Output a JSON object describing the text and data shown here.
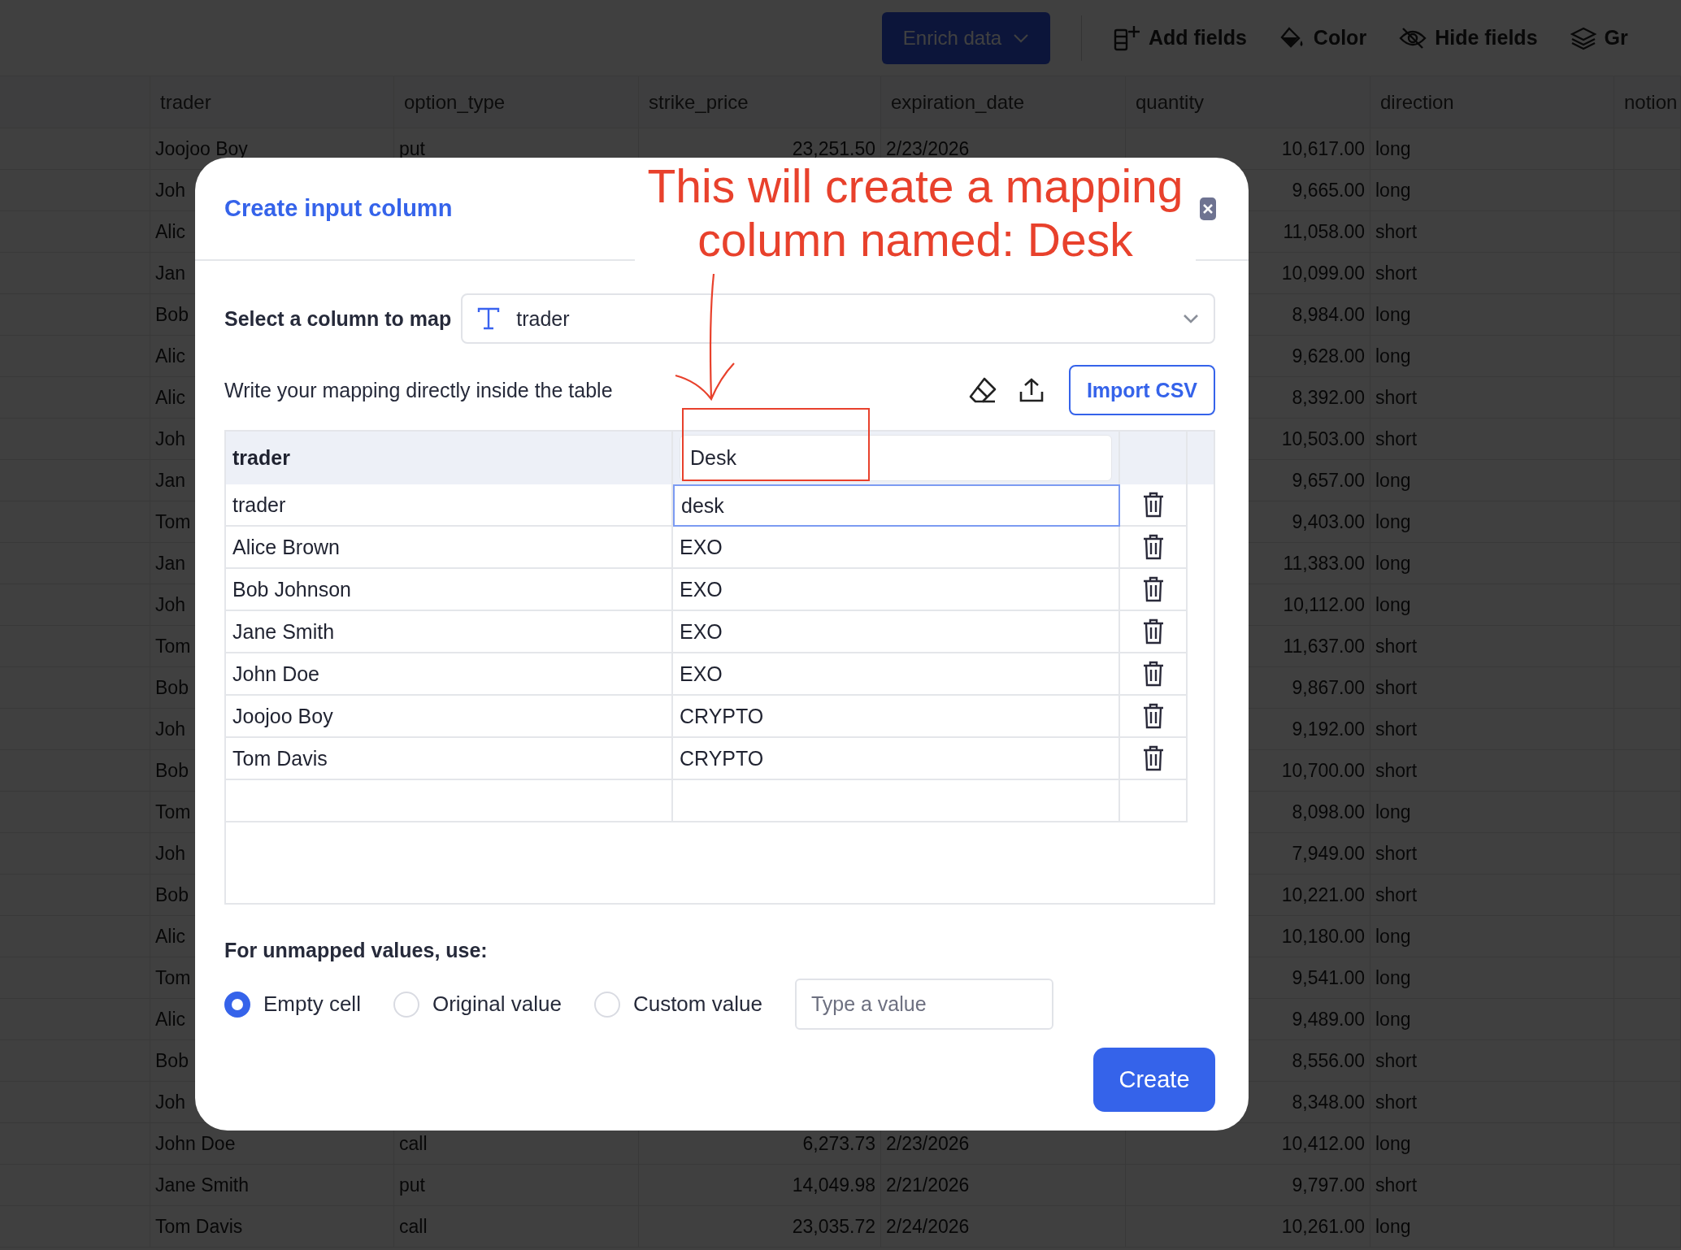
{
  "toolbar": {
    "enrich_button": "Enrich data",
    "actions": [
      {
        "kind": "add-fields",
        "label": "Add fields"
      },
      {
        "kind": "color",
        "label": "Color"
      },
      {
        "kind": "hide-fields",
        "label": "Hide fields"
      },
      {
        "kind": "group",
        "label": "Gr"
      }
    ]
  },
  "table": {
    "columns": [
      "trader",
      "option_type",
      "strike_price",
      "expiration_date",
      "quantity",
      "direction",
      "notion"
    ],
    "rows": [
      {
        "trader": "Joojoo Boy",
        "option_type": "put",
        "strike_price": "23,251.50",
        "expiration_date": "2/23/2026",
        "quantity": "10,617.00",
        "direction": "long"
      },
      {
        "trader": "Joh",
        "quantity": "9,665.00",
        "direction": "long"
      },
      {
        "trader": "Alic",
        "quantity": "11,058.00",
        "direction": "short"
      },
      {
        "trader": "Jan",
        "quantity": "10,099.00",
        "direction": "short"
      },
      {
        "trader": "Bob",
        "quantity": "8,984.00",
        "direction": "long"
      },
      {
        "trader": "Alic",
        "quantity": "9,628.00",
        "direction": "long"
      },
      {
        "trader": "Alic",
        "quantity": "8,392.00",
        "direction": "short"
      },
      {
        "trader": "Joh",
        "quantity": "10,503.00",
        "direction": "short"
      },
      {
        "trader": "Jan",
        "quantity": "9,657.00",
        "direction": "long"
      },
      {
        "trader": "Tom",
        "quantity": "9,403.00",
        "direction": "long"
      },
      {
        "trader": "Jan",
        "quantity": "11,383.00",
        "direction": "long"
      },
      {
        "trader": "Joh",
        "quantity": "10,112.00",
        "direction": "long"
      },
      {
        "trader": "Tom",
        "quantity": "11,637.00",
        "direction": "short"
      },
      {
        "trader": "Bob",
        "quantity": "9,867.00",
        "direction": "short"
      },
      {
        "trader": "Joh",
        "quantity": "9,192.00",
        "direction": "short"
      },
      {
        "trader": "Bob",
        "quantity": "10,700.00",
        "direction": "short"
      },
      {
        "trader": "Tom",
        "quantity": "8,098.00",
        "direction": "long"
      },
      {
        "trader": "Joh",
        "quantity": "7,949.00",
        "direction": "short"
      },
      {
        "trader": "Bob",
        "quantity": "10,221.00",
        "direction": "short"
      },
      {
        "trader": "Alic",
        "quantity": "10,180.00",
        "direction": "long"
      },
      {
        "trader": "Tom",
        "quantity": "9,541.00",
        "direction": "long"
      },
      {
        "trader": "Alic",
        "quantity": "9,489.00",
        "direction": "long"
      },
      {
        "trader": "Bob",
        "quantity": "8,556.00",
        "direction": "short"
      },
      {
        "trader": "Joh",
        "quantity": "8,348.00",
        "direction": "short"
      },
      {
        "trader": "John Doe",
        "option_type": "call",
        "strike_price": "6,273.73",
        "expiration_date": "2/23/2026",
        "quantity": "10,412.00",
        "direction": "long"
      },
      {
        "trader": "Jane Smith",
        "option_type": "put",
        "strike_price": "14,049.98",
        "expiration_date": "2/21/2026",
        "quantity": "9,797.00",
        "direction": "short"
      },
      {
        "trader": "Tom Davis",
        "option_type": "call",
        "strike_price": "23,035.72",
        "expiration_date": "2/24/2026",
        "quantity": "10,261.00",
        "direction": "long"
      }
    ]
  },
  "dialog": {
    "title": "Create input column",
    "column_select": {
      "label": "Select a column to map",
      "value": "trader"
    },
    "instructions": "Write your mapping directly inside the table",
    "import_button": "Import CSV",
    "mapping_table": {
      "source_header": "trader",
      "target_header": "Desk",
      "rows": [
        {
          "source": "trader",
          "target": "desk",
          "focused": true
        },
        {
          "source": "Alice Brown",
          "target": "EXO",
          "focused": false
        },
        {
          "source": "Bob Johnson",
          "target": "EXO",
          "focused": false
        },
        {
          "source": "Jane Smith",
          "target": "EXO",
          "focused": false
        },
        {
          "source": "John Doe",
          "target": "EXO",
          "focused": false
        },
        {
          "source": "Joojoo Boy",
          "target": "CRYPTO",
          "focused": false
        },
        {
          "source": "Tom Davis",
          "target": "CRYPTO",
          "focused": false
        }
      ]
    },
    "unmapped": {
      "label": "For unmapped values, use:",
      "options": [
        {
          "label": "Empty cell",
          "selected": true
        },
        {
          "label": "Original value",
          "selected": false
        },
        {
          "label": "Custom value",
          "selected": false
        }
      ],
      "custom_value": {
        "placeholder": "Type a value"
      }
    },
    "create_button": "Create"
  },
  "annotation": {
    "text": "This will create a mapping column named: Desk"
  }
}
